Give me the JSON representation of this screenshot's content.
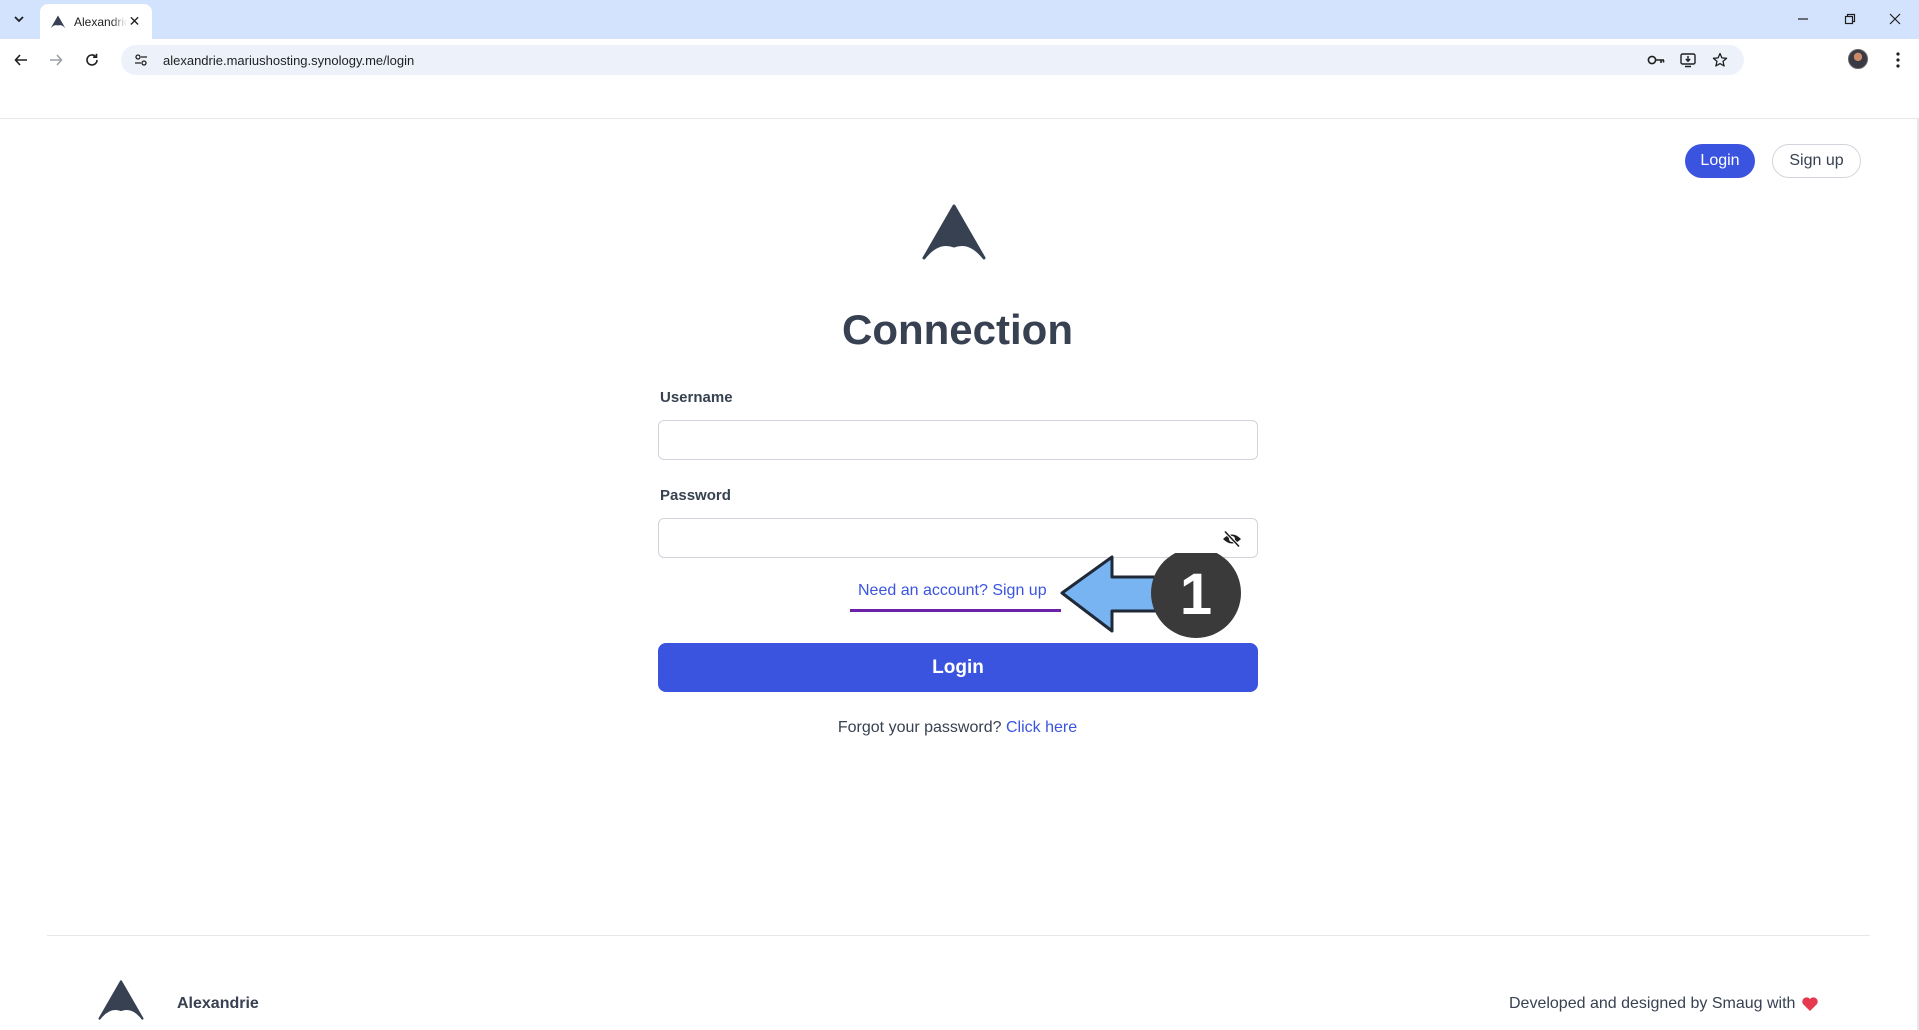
{
  "browser": {
    "tab_title": "Alexandrie",
    "url": "alexandrie.mariushosting.synology.me/login"
  },
  "header": {
    "login_label": "Login",
    "signup_label": "Sign up"
  },
  "main": {
    "title": "Connection",
    "username_label": "Username",
    "username_value": "",
    "password_label": "Password",
    "password_value": "",
    "signup_prompt": "Need an account? Sign up",
    "login_button": "Login",
    "forgot_text": "Forgot your password?",
    "forgot_link": "Click here"
  },
  "annotation": {
    "step_number": "1"
  },
  "footer": {
    "brand_name": "Alexandrie",
    "credit": "Developed and designed by Smaug with"
  },
  "colors": {
    "accent": "#3b54e0",
    "text": "#374151",
    "tabstrip": "#d3e3fd",
    "annotation_arrow": "#79b4f2",
    "annotation_underline": "#6b21a8",
    "heart": "#e63950"
  },
  "icons": {
    "tab_menu": "chevron-down-icon",
    "favicon": "alexandrie-logo-icon",
    "tab_close": "close-icon",
    "back": "back-arrow-icon",
    "forward": "forward-arrow-icon",
    "reload": "reload-icon",
    "site_info": "tune-icon",
    "password_key": "key-icon",
    "install": "install-app-icon",
    "bookmark": "star-icon",
    "menu": "kebab-menu-icon",
    "password_visibility": "eye-off-icon",
    "footer_heart": "heart-icon"
  }
}
